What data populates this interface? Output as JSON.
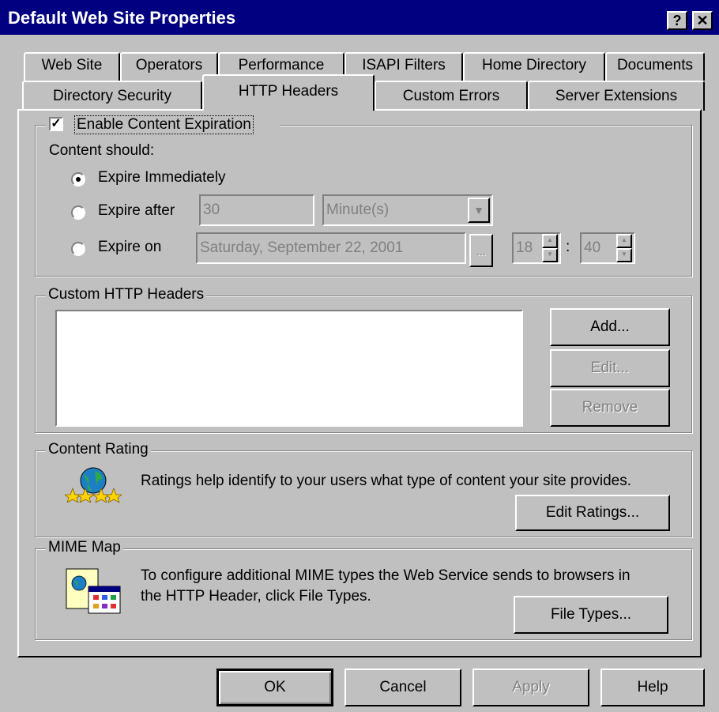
{
  "window": {
    "title": "Default Web Site Properties",
    "help_glyph": "?",
    "close_glyph": "✕"
  },
  "tabs_row1": [
    "Web Site",
    "Operators",
    "Performance",
    "ISAPI Filters",
    "Home Directory",
    "Documents"
  ],
  "tabs_row2": [
    "Directory Security",
    "HTTP Headers",
    "Custom Errors",
    "Server Extensions"
  ],
  "active_tab": "HTTP Headers",
  "expiration": {
    "enable_label": "Enable Content Expiration",
    "enabled": true,
    "content_should": "Content should:",
    "options": [
      {
        "label": "Expire Immediately",
        "selected": true
      },
      {
        "label": "Expire after",
        "selected": false
      },
      {
        "label": "Expire on",
        "selected": false
      }
    ],
    "after_value": "30",
    "after_unit": "Minute(s)",
    "date_value": "Saturday, September 22, 2001",
    "date_button": "...",
    "hour": "18",
    "separator": ":",
    "minute": "40"
  },
  "custom_headers": {
    "label": "Custom HTTP Headers",
    "add": "Add...",
    "edit": "Edit...",
    "remove": "Remove"
  },
  "content_rating": {
    "label": "Content Rating",
    "text": "Ratings help identify to your users what type of content your site provides.",
    "button": "Edit Ratings..."
  },
  "mime_map": {
    "label": "MIME Map",
    "text": "To configure additional MIME types the Web Service sends to browsers in the HTTP Header, click File Types.",
    "button": "File Types..."
  },
  "footer": {
    "ok": "OK",
    "cancel": "Cancel",
    "apply": "Apply",
    "help": "Help"
  },
  "icons": {
    "rating": "globe-stars-icon",
    "mime": "window-grid-icon"
  },
  "colors": {
    "titlebar": "#000080",
    "face": "#c0c0c0",
    "disabled_text": "#808080"
  }
}
